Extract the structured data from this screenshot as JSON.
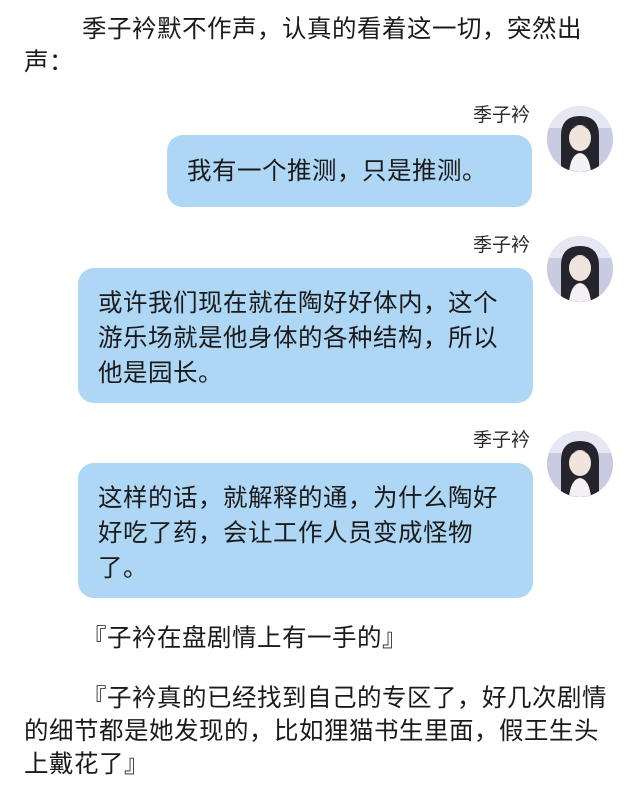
{
  "intro": {
    "text": "季子衿默不作声，认真的看着这一切，突然出声："
  },
  "messages": [
    {
      "speaker": "季子衿",
      "text": "我有一个推测，只是推测。"
    },
    {
      "speaker": "季子衿",
      "text": "或许我们现在就在陶好好体内，这个游乐场就是他身体的各种结构，所以他是园长。"
    },
    {
      "speaker": "季子衿",
      "text": "这样的话，就解释的通，为什么陶好好吃了药，会让工作人员变成怪物了。"
    }
  ],
  "comments": [
    {
      "text": "『子衿在盘剧情上有一手的』"
    },
    {
      "text": "『子衿真的已经找到自己的专区了，好几次剧情的细节都是她发现的，比如狸猫书生里面，假王生头上戴花了』"
    }
  ]
}
